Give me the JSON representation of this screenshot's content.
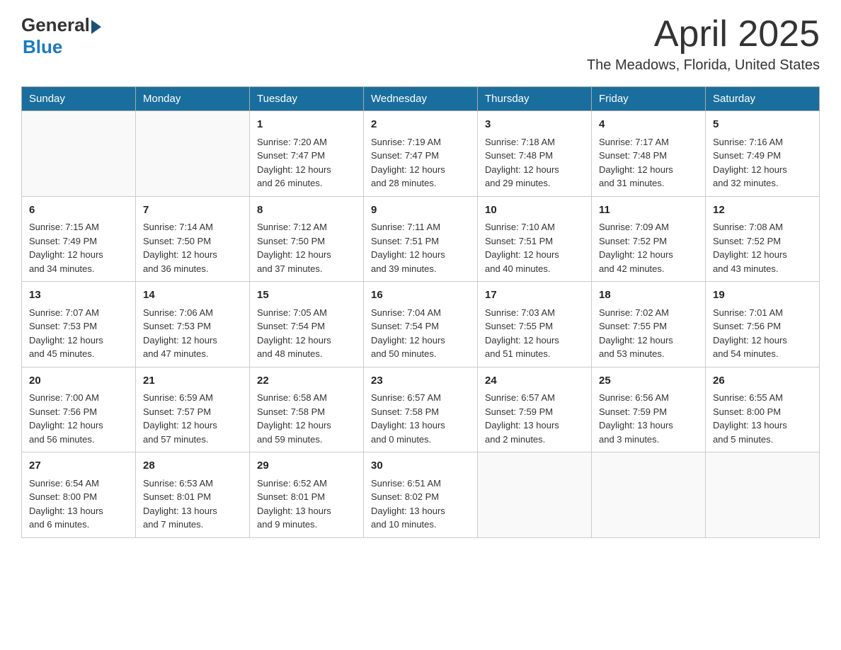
{
  "logo": {
    "general": "General",
    "blue": "Blue"
  },
  "header": {
    "month_year": "April 2025",
    "location": "The Meadows, Florida, United States"
  },
  "days_of_week": [
    "Sunday",
    "Monday",
    "Tuesday",
    "Wednesday",
    "Thursday",
    "Friday",
    "Saturday"
  ],
  "weeks": [
    [
      {
        "day": "",
        "info": ""
      },
      {
        "day": "",
        "info": ""
      },
      {
        "day": "1",
        "info": "Sunrise: 7:20 AM\nSunset: 7:47 PM\nDaylight: 12 hours\nand 26 minutes."
      },
      {
        "day": "2",
        "info": "Sunrise: 7:19 AM\nSunset: 7:47 PM\nDaylight: 12 hours\nand 28 minutes."
      },
      {
        "day": "3",
        "info": "Sunrise: 7:18 AM\nSunset: 7:48 PM\nDaylight: 12 hours\nand 29 minutes."
      },
      {
        "day": "4",
        "info": "Sunrise: 7:17 AM\nSunset: 7:48 PM\nDaylight: 12 hours\nand 31 minutes."
      },
      {
        "day": "5",
        "info": "Sunrise: 7:16 AM\nSunset: 7:49 PM\nDaylight: 12 hours\nand 32 minutes."
      }
    ],
    [
      {
        "day": "6",
        "info": "Sunrise: 7:15 AM\nSunset: 7:49 PM\nDaylight: 12 hours\nand 34 minutes."
      },
      {
        "day": "7",
        "info": "Sunrise: 7:14 AM\nSunset: 7:50 PM\nDaylight: 12 hours\nand 36 minutes."
      },
      {
        "day": "8",
        "info": "Sunrise: 7:12 AM\nSunset: 7:50 PM\nDaylight: 12 hours\nand 37 minutes."
      },
      {
        "day": "9",
        "info": "Sunrise: 7:11 AM\nSunset: 7:51 PM\nDaylight: 12 hours\nand 39 minutes."
      },
      {
        "day": "10",
        "info": "Sunrise: 7:10 AM\nSunset: 7:51 PM\nDaylight: 12 hours\nand 40 minutes."
      },
      {
        "day": "11",
        "info": "Sunrise: 7:09 AM\nSunset: 7:52 PM\nDaylight: 12 hours\nand 42 minutes."
      },
      {
        "day": "12",
        "info": "Sunrise: 7:08 AM\nSunset: 7:52 PM\nDaylight: 12 hours\nand 43 minutes."
      }
    ],
    [
      {
        "day": "13",
        "info": "Sunrise: 7:07 AM\nSunset: 7:53 PM\nDaylight: 12 hours\nand 45 minutes."
      },
      {
        "day": "14",
        "info": "Sunrise: 7:06 AM\nSunset: 7:53 PM\nDaylight: 12 hours\nand 47 minutes."
      },
      {
        "day": "15",
        "info": "Sunrise: 7:05 AM\nSunset: 7:54 PM\nDaylight: 12 hours\nand 48 minutes."
      },
      {
        "day": "16",
        "info": "Sunrise: 7:04 AM\nSunset: 7:54 PM\nDaylight: 12 hours\nand 50 minutes."
      },
      {
        "day": "17",
        "info": "Sunrise: 7:03 AM\nSunset: 7:55 PM\nDaylight: 12 hours\nand 51 minutes."
      },
      {
        "day": "18",
        "info": "Sunrise: 7:02 AM\nSunset: 7:55 PM\nDaylight: 12 hours\nand 53 minutes."
      },
      {
        "day": "19",
        "info": "Sunrise: 7:01 AM\nSunset: 7:56 PM\nDaylight: 12 hours\nand 54 minutes."
      }
    ],
    [
      {
        "day": "20",
        "info": "Sunrise: 7:00 AM\nSunset: 7:56 PM\nDaylight: 12 hours\nand 56 minutes."
      },
      {
        "day": "21",
        "info": "Sunrise: 6:59 AM\nSunset: 7:57 PM\nDaylight: 12 hours\nand 57 minutes."
      },
      {
        "day": "22",
        "info": "Sunrise: 6:58 AM\nSunset: 7:58 PM\nDaylight: 12 hours\nand 59 minutes."
      },
      {
        "day": "23",
        "info": "Sunrise: 6:57 AM\nSunset: 7:58 PM\nDaylight: 13 hours\nand 0 minutes."
      },
      {
        "day": "24",
        "info": "Sunrise: 6:57 AM\nSunset: 7:59 PM\nDaylight: 13 hours\nand 2 minutes."
      },
      {
        "day": "25",
        "info": "Sunrise: 6:56 AM\nSunset: 7:59 PM\nDaylight: 13 hours\nand 3 minutes."
      },
      {
        "day": "26",
        "info": "Sunrise: 6:55 AM\nSunset: 8:00 PM\nDaylight: 13 hours\nand 5 minutes."
      }
    ],
    [
      {
        "day": "27",
        "info": "Sunrise: 6:54 AM\nSunset: 8:00 PM\nDaylight: 13 hours\nand 6 minutes."
      },
      {
        "day": "28",
        "info": "Sunrise: 6:53 AM\nSunset: 8:01 PM\nDaylight: 13 hours\nand 7 minutes."
      },
      {
        "day": "29",
        "info": "Sunrise: 6:52 AM\nSunset: 8:01 PM\nDaylight: 13 hours\nand 9 minutes."
      },
      {
        "day": "30",
        "info": "Sunrise: 6:51 AM\nSunset: 8:02 PM\nDaylight: 13 hours\nand 10 minutes."
      },
      {
        "day": "",
        "info": ""
      },
      {
        "day": "",
        "info": ""
      },
      {
        "day": "",
        "info": ""
      }
    ]
  ]
}
